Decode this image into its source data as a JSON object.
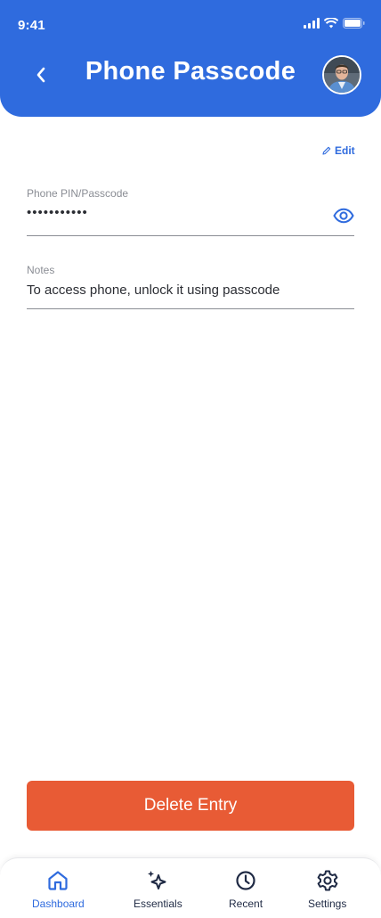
{
  "status_bar": {
    "time": "9:41"
  },
  "header": {
    "title": "Phone Passcode"
  },
  "edit": {
    "label": "Edit"
  },
  "fields": {
    "pin": {
      "label": "Phone PIN/Passcode",
      "value": "•••••••••••"
    },
    "notes": {
      "label": "Notes",
      "value": "To access phone, unlock it using passcode"
    }
  },
  "actions": {
    "delete_label": "Delete Entry"
  },
  "tabs": [
    {
      "label": "Dashboard",
      "icon": "home-icon",
      "active": true
    },
    {
      "label": "Essentials",
      "icon": "sparkle-icon",
      "active": false
    },
    {
      "label": "Recent",
      "icon": "clock-icon",
      "active": false
    },
    {
      "label": "Settings",
      "icon": "gear-icon",
      "active": false
    }
  ],
  "colors": {
    "primary": "#2f6bde",
    "danger": "#e85b35",
    "text": "#2b2d33",
    "muted": "#8a8d94"
  }
}
